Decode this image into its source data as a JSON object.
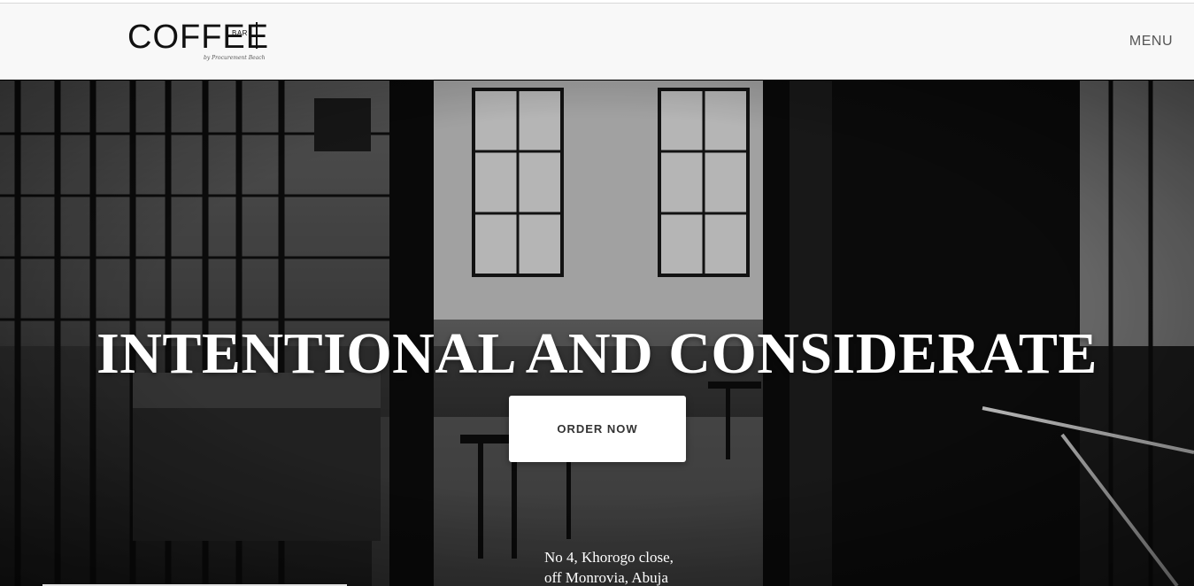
{
  "header": {
    "logo": {
      "word": "COFFEE",
      "sub": "BAR",
      "signature": "by Procurement Beach"
    },
    "menu_label": "MENU"
  },
  "hero": {
    "title": "INTENTIONAL AND CONSIDERATE",
    "cta_label": "ORDER NOW",
    "address_line1": "No 4, Khorogo close,",
    "address_line2": "off Monrovia, Abuja"
  },
  "colors": {
    "header_bg": "#f8f8f8",
    "hero_text": "#ffffff",
    "button_bg": "#ffffff",
    "button_text": "#333333"
  }
}
